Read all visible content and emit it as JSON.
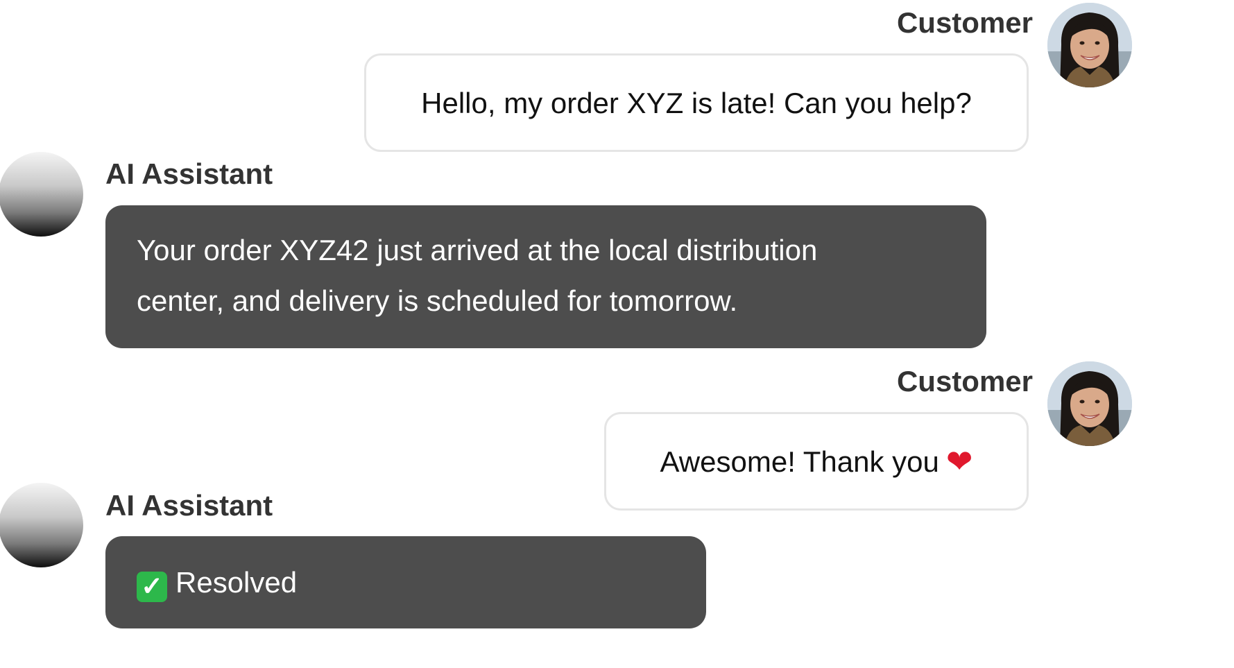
{
  "messages": [
    {
      "role": "customer",
      "name": "Customer",
      "text": "Hello, my order XYZ is late! Can you help?"
    },
    {
      "role": "assistant",
      "name": "AI Assistant",
      "lines": [
        "Your order XYZ42 just arrived at the local distribution",
        "center, and delivery is scheduled for tomorrow."
      ]
    },
    {
      "role": "customer",
      "name": "Customer",
      "text": "Awesome! Thank you",
      "emoji": "❤"
    },
    {
      "role": "assistant",
      "name": "AI Assistant",
      "text": "Resolved",
      "emoji": "✓"
    }
  ],
  "colors": {
    "assistant_bubble": "#4d4d4d",
    "customer_bubble_border": "#e5e5e5",
    "name_text": "#333333",
    "heart": "#e0182d",
    "check_box": "#2db84b"
  },
  "icons": {
    "customer_avatar": "customer-avatar-photo",
    "assistant_avatar": "assistant-avatar-gradient",
    "heart": "red-heart-emoji",
    "check": "check-mark-button-emoji"
  }
}
